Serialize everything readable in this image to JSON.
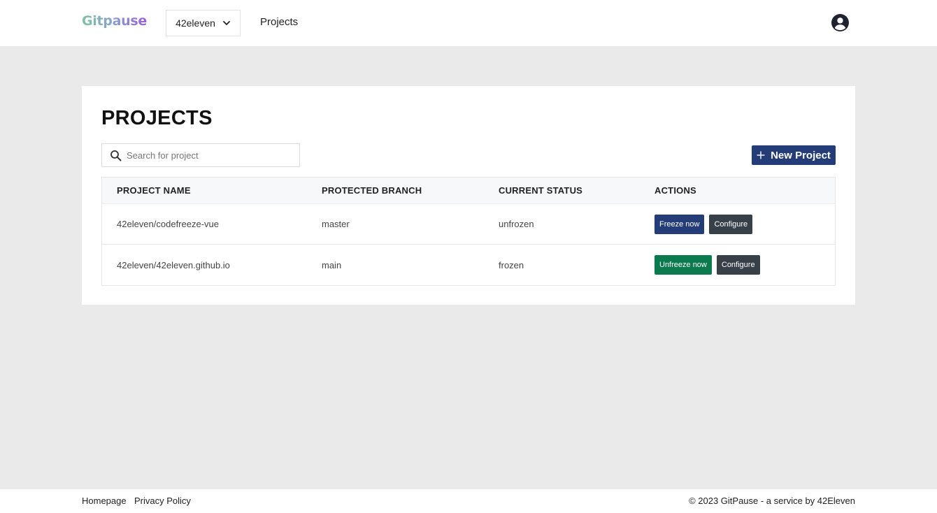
{
  "header": {
    "logo_text": "Gitpause",
    "org_selector": {
      "value": "42eleven"
    },
    "nav_projects": "Projects"
  },
  "main": {
    "title": "PROJECTS",
    "search": {
      "placeholder": "Search for project",
      "value": ""
    },
    "new_project_label": "New Project",
    "table": {
      "headers": [
        "PROJECT NAME",
        "PROTECTED BRANCH",
        "CURRENT STATUS",
        "ACTIONS"
      ],
      "rows": [
        {
          "name": "42eleven/codefreeze-vue",
          "branch": "master",
          "status": "unfrozen",
          "primary_action": "Freeze now",
          "secondary_action": "Configure"
        },
        {
          "name": "42eleven/42eleven.github.io",
          "branch": "main",
          "status": "frozen",
          "primary_action": "Unfreeze now",
          "secondary_action": "Configure"
        }
      ]
    }
  },
  "footer": {
    "homepage": "Homepage",
    "privacy": "Privacy Policy",
    "copyright": "© 2023 GitPause - a service by 42Eleven"
  },
  "colors": {
    "primary": "#243c78",
    "success": "#0b7a4f",
    "dark": "#374048",
    "background": "#ebeaea"
  },
  "icons": {
    "org_dropdown": "chevron-down-icon",
    "account": "user-circle-icon",
    "search": "search-icon",
    "new_project": "plus-icon"
  }
}
